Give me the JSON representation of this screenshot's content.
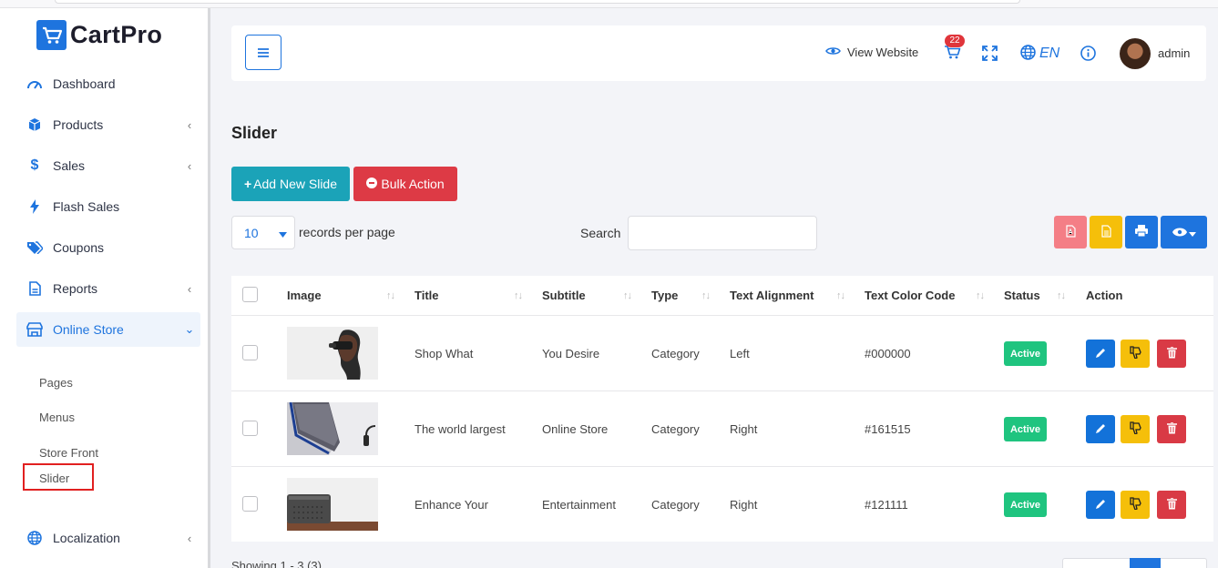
{
  "brand": {
    "name": "CartPro"
  },
  "sidebar": {
    "items": [
      {
        "label": "Dashboard",
        "icon": "speedometer-icon",
        "has_children": false
      },
      {
        "label": "Products",
        "icon": "cube-icon",
        "has_children": true
      },
      {
        "label": "Sales",
        "icon": "dollar-icon",
        "has_children": true
      },
      {
        "label": "Flash Sales",
        "icon": "bolt-icon",
        "has_children": false
      },
      {
        "label": "Coupons",
        "icon": "tags-icon",
        "has_children": false
      },
      {
        "label": "Reports",
        "icon": "file-icon",
        "has_children": true
      },
      {
        "label": "Online Store",
        "icon": "store-icon",
        "has_children": true,
        "expanded": true
      },
      {
        "label": "Localization",
        "icon": "globe-icon",
        "has_children": true
      }
    ],
    "online_store_sub": [
      "Pages",
      "Menus",
      "Store Front",
      "Slider"
    ],
    "active_sub": "Slider"
  },
  "header": {
    "view_website": "View Website",
    "cart_count": "22",
    "language": "EN",
    "user": "admin"
  },
  "page": {
    "title": "Slider",
    "add_button": "Add New Slide",
    "bulk_button": "Bulk Action",
    "per_page_value": "10",
    "per_page_label": "records per page",
    "search_label": "Search",
    "search_placeholder": "",
    "showing": "Showing 1 - 3 (3)"
  },
  "table": {
    "columns": [
      "Image",
      "Title",
      "Subtitle",
      "Type",
      "Text Alignment",
      "Text Color Code",
      "Status",
      "Action"
    ],
    "rows": [
      {
        "image": "vr-headset-woman",
        "title": "Shop What",
        "subtitle": "You Desire",
        "type": "Category",
        "align": "Left",
        "color": "#000000",
        "status": "Active"
      },
      {
        "image": "smartwatch-strap",
        "title": "The world largest",
        "subtitle": "Online Store",
        "type": "Category",
        "align": "Right",
        "color": "#161515",
        "status": "Active"
      },
      {
        "image": "speaker-on-table",
        "title": "Enhance Your",
        "subtitle": "Entertainment",
        "type": "Category",
        "align": "Right",
        "color": "#121111",
        "status": "Active"
      }
    ]
  },
  "colors": {
    "primary": "#1e74de",
    "teal": "#1ba3b8",
    "danger": "#dd3a45",
    "warning": "#f5bf0a",
    "success": "#1fc47f",
    "pdf": "#f47e86"
  }
}
